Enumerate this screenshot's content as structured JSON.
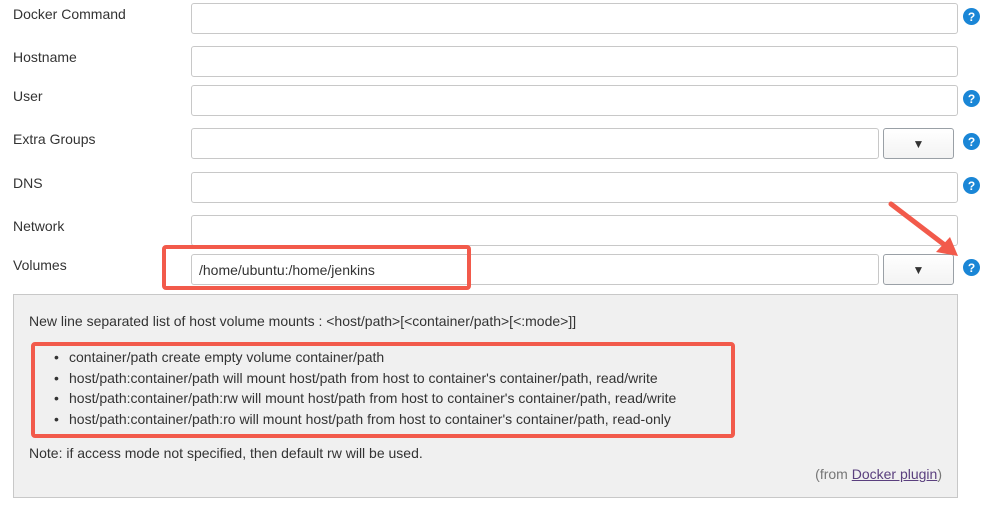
{
  "fields": [
    {
      "label": "Docker Command",
      "value": "",
      "has_help": true
    },
    {
      "label": "Hostname",
      "value": "",
      "has_help": false
    },
    {
      "label": "User",
      "value": "",
      "has_help": true
    },
    {
      "label": "Extra Groups",
      "value": "",
      "has_help": true,
      "dropdown": "▼"
    },
    {
      "label": "DNS",
      "value": "",
      "has_help": true
    },
    {
      "label": "Network",
      "value": "",
      "has_help": false
    },
    {
      "label": "Volumes",
      "value": "/home/ubuntu:/home/jenkins",
      "has_help": true,
      "dropdown": "▼"
    }
  ],
  "help_icon_glyph": "?",
  "help": {
    "intro": "New line separated list of host volume mounts : <host/path>[<container/path>[<:mode>]]",
    "items": [
      "container/path create empty volume container/path",
      "host/path:container/path will mount host/path from host to container's container/path, read/write",
      "host/path:container/path:rw will mount host/path from host to container's container/path, read/write",
      "host/path:container/path:ro will mount host/path from host to container's container/path, read-only"
    ],
    "note": "Note: if access mode not specified, then default rw will be used.",
    "from_prefix": "(from ",
    "from_link": "Docker plugin",
    "from_suffix": ")"
  },
  "colors": {
    "highlight": "#f25a4b",
    "help_icon": "#1a86d6",
    "helpbox_bg": "#f0f0f0",
    "link": "#5a3f7e"
  }
}
